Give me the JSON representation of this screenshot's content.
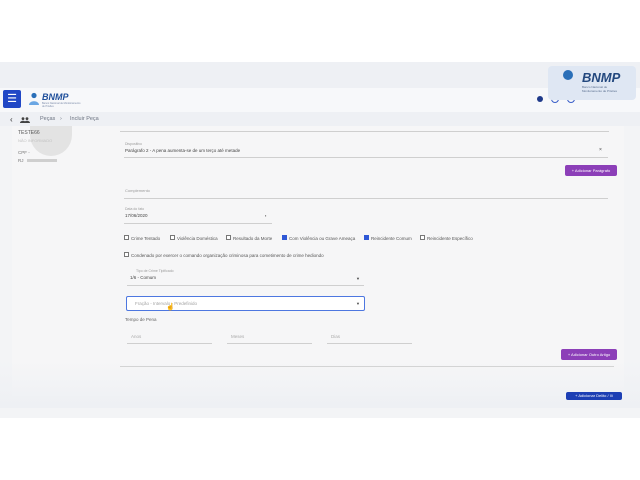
{
  "watermark": {
    "title": "BNMP",
    "subtitle": "Banco Nacional de Monitoramento de Prisões"
  },
  "header": {
    "menu_icon": "menu-icon",
    "logo_text": "BNMP",
    "logo_subtitle": "Banco Nacional de Monitoramento de Prisões"
  },
  "breadcrumb": {
    "back": "‹",
    "people_icon": "people-icon",
    "items": [
      "Peças",
      "›",
      "Incluir Peça"
    ]
  },
  "sidebar": {
    "name": "TESTE66",
    "faded": "NÃO INFORMADO",
    "cpf_label": "CPF -",
    "rg_label": "RJ"
  },
  "form": {
    "legal_label": "Dispositivo",
    "legal_value": "Parágrafo 2 - A pena aumenta-se de um terço até metade",
    "add_paragraph": "+ Adicionar Parágrafo",
    "complement_label": "Complemento",
    "date_label": "Data do fato",
    "date_value": "17/06/2020",
    "checkboxes": [
      {
        "label": "Crime Tentado",
        "checked": false
      },
      {
        "label": "Violência Doméstica",
        "checked": false
      },
      {
        "label": "Resultado da Morte",
        "checked": false
      },
      {
        "label": "Com Violência ou Grave Ameaça",
        "checked": true
      },
      {
        "label": "Reincidente Comum",
        "checked": true
      },
      {
        "label": "Reincidente Específico",
        "checked": false
      }
    ],
    "long_checkbox": "Condenado por exercer o comando organização criminosa para cometimento de crime hediondo",
    "regime_label": "Tipo de Crime Tipificado",
    "regime_value": "1/6 - Comum",
    "select_placeholder": "Fração - Intervalo - Predefinido",
    "pena_label": "Tempo de Pena",
    "years": "Anos",
    "months": "Meses",
    "days": "Dias",
    "add_article": "+ Adicionar Outro Artigo",
    "add_offense": "+ Adicionar Delito / Ilí"
  }
}
